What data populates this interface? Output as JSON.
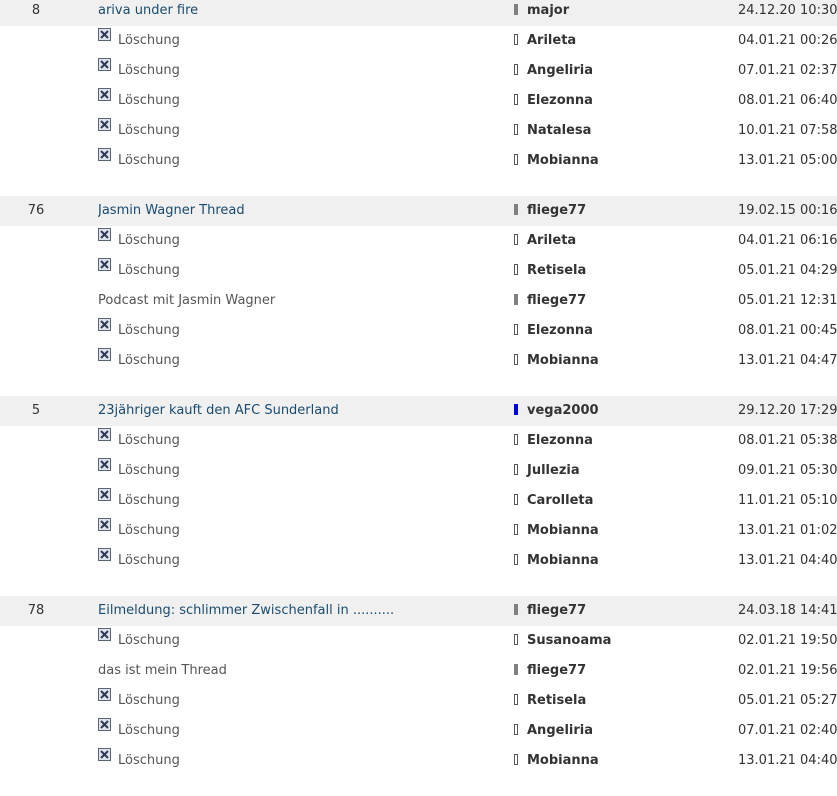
{
  "delete_icon": "delete-x-icon",
  "threads": [
    {
      "count": "8",
      "title": "ariva under fire",
      "user": "major",
      "user_marker": "grey",
      "date": "24.12.20 10:30",
      "posts": [
        {
          "type": "deleted",
          "label": "Löschung",
          "user": "Arileta",
          "user_marker": "outline",
          "date": "04.01.21 00:26"
        },
        {
          "type": "deleted",
          "label": "Löschung",
          "user": "Angeliria",
          "user_marker": "outline",
          "date": "07.01.21 02:37"
        },
        {
          "type": "deleted",
          "label": "Löschung",
          "user": "Elezonna",
          "user_marker": "outline",
          "date": "08.01.21 06:40"
        },
        {
          "type": "deleted",
          "label": "Löschung",
          "user": "Natalesa",
          "user_marker": "outline",
          "date": "10.01.21 07:58"
        },
        {
          "type": "deleted",
          "label": "Löschung",
          "user": "Mobianna",
          "user_marker": "outline",
          "date": "13.01.21 05:00"
        }
      ]
    },
    {
      "count": "76",
      "title": "Jasmin Wagner Thread",
      "user": "fliege77",
      "user_marker": "grey",
      "date": "19.02.15 00:16",
      "posts": [
        {
          "type": "deleted",
          "label": "Löschung",
          "user": "Arileta",
          "user_marker": "outline",
          "date": "04.01.21 06:16"
        },
        {
          "type": "deleted",
          "label": "Löschung",
          "user": "Retisela",
          "user_marker": "outline",
          "date": "05.01.21 04:29"
        },
        {
          "type": "post",
          "label": "Podcast mit Jasmin Wagner",
          "user": "fliege77",
          "user_marker": "grey",
          "date": "05.01.21 12:31"
        },
        {
          "type": "deleted",
          "label": "Löschung",
          "user": "Elezonna",
          "user_marker": "outline",
          "date": "08.01.21 00:45"
        },
        {
          "type": "deleted",
          "label": "Löschung",
          "user": "Mobianna",
          "user_marker": "outline",
          "date": "13.01.21 04:47"
        }
      ]
    },
    {
      "count": "5",
      "title": "23jähriger kauft den AFC Sunderland",
      "user": "vega2000",
      "user_marker": "blue",
      "date": "29.12.20 17:29",
      "posts": [
        {
          "type": "deleted",
          "label": "Löschung",
          "user": "Elezonna",
          "user_marker": "outline",
          "date": "08.01.21 05:38"
        },
        {
          "type": "deleted",
          "label": "Löschung",
          "user": "Jullezia",
          "user_marker": "outline",
          "date": "09.01.21 05:30"
        },
        {
          "type": "deleted",
          "label": "Löschung",
          "user": "Carolleta",
          "user_marker": "outline",
          "date": "11.01.21 05:10"
        },
        {
          "type": "deleted",
          "label": "Löschung",
          "user": "Mobianna",
          "user_marker": "outline",
          "date": "13.01.21 01:02"
        },
        {
          "type": "deleted",
          "label": "Löschung",
          "user": "Mobianna",
          "user_marker": "outline",
          "date": "13.01.21 04:40"
        }
      ]
    },
    {
      "count": "78",
      "title": "Eilmeldung: schlimmer Zwischenfall in ..........",
      "user": "fliege77",
      "user_marker": "grey",
      "date": "24.03.18 14:41",
      "posts": [
        {
          "type": "deleted",
          "label": "Löschung",
          "user": "Susanoama",
          "user_marker": "outline",
          "date": "02.01.21 19:50"
        },
        {
          "type": "post",
          "label": "das ist mein Thread",
          "user": "fliege77",
          "user_marker": "grey",
          "date": "02.01.21 19:56"
        },
        {
          "type": "deleted",
          "label": "Löschung",
          "user": "Retisela",
          "user_marker": "outline",
          "date": "05.01.21 05:27"
        },
        {
          "type": "deleted",
          "label": "Löschung",
          "user": "Angeliria",
          "user_marker": "outline",
          "date": "07.01.21 02:40"
        },
        {
          "type": "deleted",
          "label": "Löschung",
          "user": "Mobianna",
          "user_marker": "outline",
          "date": "13.01.21 04:40"
        }
      ]
    }
  ]
}
